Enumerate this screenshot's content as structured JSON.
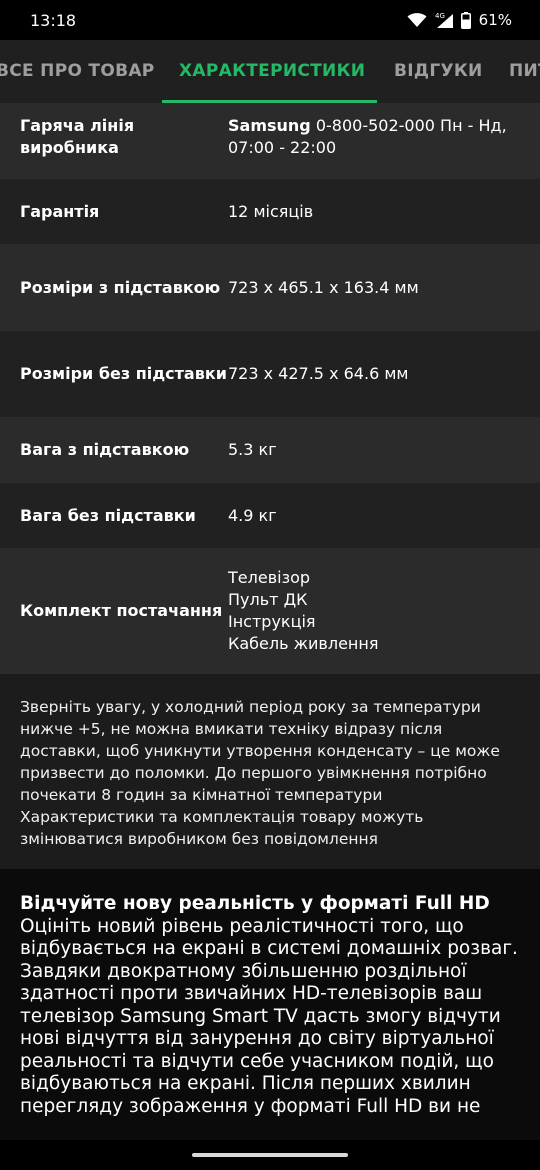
{
  "status_bar": {
    "time": "13:18",
    "network": "4G",
    "battery": "61%"
  },
  "tabs": [
    {
      "label": "ВСЕ ПРО ТОВАР",
      "active": false
    },
    {
      "label": "ХАРАКТЕРИСТИКИ",
      "active": true
    },
    {
      "label": "ВІДГУКИ",
      "active": false
    },
    {
      "label": "ПИТАННЯ",
      "active": false
    }
  ],
  "specs": [
    {
      "label": "Гаряча лінія виробника",
      "value_brand": "Samsung",
      "value": "0-800-502-000 Пн - Нд, 07:00 - 22:00"
    },
    {
      "label": "Гарантія",
      "value": "12 місяців"
    },
    {
      "label": "Розміри з підставкою",
      "value": "723 x 465.1 x 163.4 мм"
    },
    {
      "label": "Розміри без підставки",
      "value": "723 x 427.5 x 64.6 мм"
    },
    {
      "label": "Вага з підставкою",
      "value": "5.3 кг"
    },
    {
      "label": "Вага без підставки",
      "value": "4.9 кг"
    },
    {
      "label": "Комплект постачання",
      "value_lines": [
        "Телевізор",
        "Пульт ДК",
        "Інструкція",
        "Кабель живлення"
      ]
    }
  ],
  "notice": {
    "text": "Зверніть увагу, у холодний період року за температури нижче +5, не можна вмикати техніку відразу після доставки, щоб уникнути утворення конденсату – це може призвести до поломки. До першого увімкнення потрібно почекати 8 годин за кімнатної температури Характеристики та комплектація товару можуть змінюватися виробником без повідомлення"
  },
  "description": {
    "title": "Відчуйте нову реальність у форматі Full HD",
    "text": "Оцініть новий рівень реалістичності того, що відбувається на екрані в системі домашніх розваг. Завдяки двократному збільшенню роздільної здатності проти звичайних HD-телевізорів ваш телевізор Samsung Smart TV дасть змогу відчути нові відчуття від занурення до світу віртуальної реальності та відчути себе учасником подій, що відбуваються на екрані. Після перших хвилин перегляду зображення у форматі Full HD ви не"
  },
  "colors": {
    "accent": "#25b866",
    "tab_inactive": "#9e9e9e",
    "row_odd": "#2b2b2b",
    "row_even": "#212121"
  }
}
